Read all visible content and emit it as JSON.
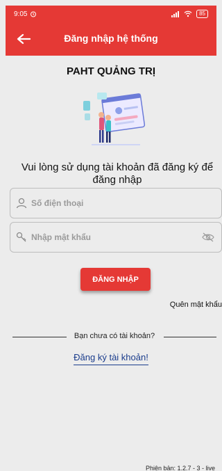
{
  "status_bar": {
    "time": "9:05",
    "battery": "85"
  },
  "header": {
    "title": "Đăng nhập hệ thống"
  },
  "app": {
    "name": "PAHT QUẢNG TRỊ"
  },
  "subtitle": "Vui lòng sử dụng tài khoản đã đăng ký để đăng nhập",
  "form": {
    "phone_placeholder": "Số điện thoại",
    "password_placeholder": "Nhập mật khẩu",
    "login_label": "ĐĂNG NHẬP",
    "forgot_label": "Quên mật khẩu"
  },
  "signup": {
    "prompt": "Bạn chưa có tài khoản?",
    "link_label": "Đăng ký tài khoản!"
  },
  "footer": {
    "version": "Phiên bản: 1.2.7 - 3 - live"
  },
  "colors": {
    "primary": "#e53935",
    "link": "#1a3c8c",
    "background": "#ececec"
  },
  "icons": [
    "alarm-icon",
    "signal-icon",
    "wifi-icon",
    "battery-icon",
    "back-arrow-icon",
    "user-icon",
    "key-icon",
    "eye-off-icon"
  ]
}
